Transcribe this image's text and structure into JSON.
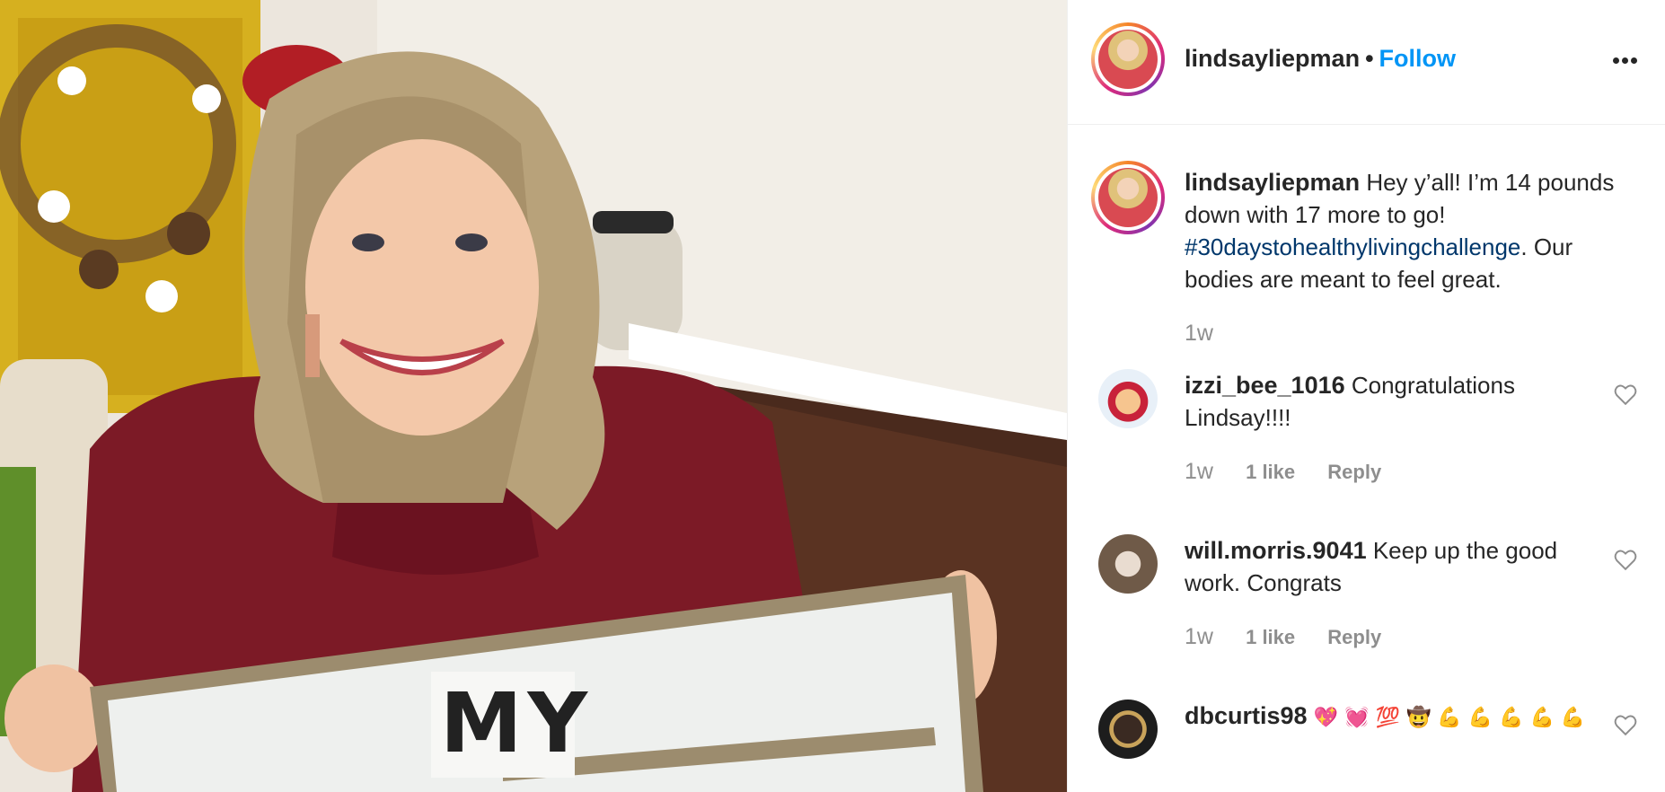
{
  "post": {
    "author": "lindsayliepman",
    "separator": "•",
    "follow_label": "Follow",
    "more_icon": "more-horizontal-icon"
  },
  "caption": {
    "username": "lindsayliepman",
    "text_before": "Hey y’all! I’m 14 pounds down with 17 more to go!",
    "hashtag": "#30daystohealthylivingchallenge",
    "text_after": ". Our bodies are meant to feel great.",
    "time": "1w"
  },
  "comments": [
    {
      "username": "izzi_bee_1016",
      "text": "Congratulations Lindsay!!!!",
      "time": "1w",
      "likes": "1 like",
      "reply": "Reply"
    },
    {
      "username": "will.morris.9041",
      "text": "Keep up the good work. Congrats",
      "time": "1w",
      "likes": "1 like",
      "reply": "Reply"
    },
    {
      "username": "dbcurtis98",
      "text": "💖 💓 💯 🤠 💪 💪 💪 💪 💪"
    }
  ],
  "photo": {
    "letterboard_text": "MY"
  },
  "colors": {
    "link": "#0095f6",
    "hashtag": "#00376b",
    "muted": "#8e8e8e",
    "text": "#262626"
  }
}
